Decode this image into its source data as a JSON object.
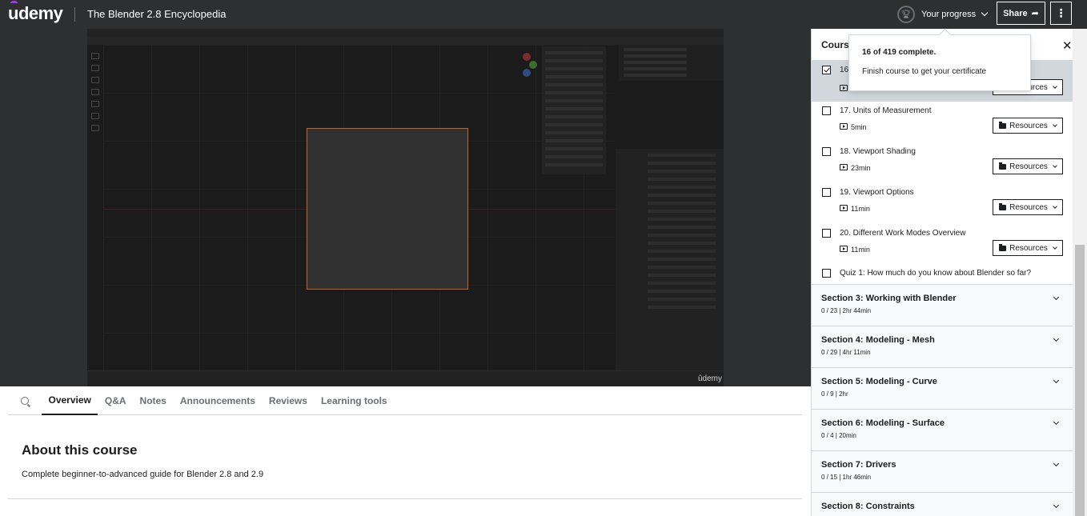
{
  "header": {
    "logo": "udemy",
    "course_title": "The Blender 2.8 Encyclopedia",
    "progress_label": "Your progress",
    "share_label": "Share",
    "more_label": "⋮"
  },
  "video": {
    "watermark": "ûdemy"
  },
  "tabs": {
    "items": [
      "Overview",
      "Q&A",
      "Notes",
      "Announcements",
      "Reviews",
      "Learning tools"
    ],
    "active": "Overview"
  },
  "about": {
    "title": "About this course",
    "description": "Complete beginner-to-advanced guide for Blender 2.8 and 2.9"
  },
  "sidebar": {
    "title": "Course content",
    "resources_label": "Resources",
    "lectures": [
      {
        "title": "16. ",
        "duration": "",
        "checked": true,
        "current": true
      },
      {
        "title": "17. Units of Measurement",
        "duration": "5min",
        "checked": false
      },
      {
        "title": "18. Viewport Shading",
        "duration": "23min",
        "checked": false
      },
      {
        "title": "19. Viewport Options",
        "duration": "11min",
        "checked": false
      },
      {
        "title": "20. Different Work Modes Overview",
        "duration": "11min",
        "checked": false
      }
    ],
    "quiz": {
      "title": "Quiz 1: How much do you know about Blender so far?"
    },
    "sections": [
      {
        "title": "Section 3: Working with Blender",
        "meta": "0 / 23 | 2hr 44min"
      },
      {
        "title": "Section 4: Modeling - Mesh",
        "meta": "0 / 29 | 4hr 11min"
      },
      {
        "title": "Section 5: Modeling - Curve",
        "meta": "0 / 9 | 2hr"
      },
      {
        "title": "Section 6: Modeling - Surface",
        "meta": "0 / 4 | 20min"
      },
      {
        "title": "Section 7: Drivers",
        "meta": "0 / 15 | 1hr 46min"
      },
      {
        "title": "Section 8: Constraints",
        "meta": ""
      }
    ]
  },
  "popup": {
    "main": "16 of 419 complete.",
    "sub": "Finish course to get your certificate"
  },
  "colors": {
    "header_bg": "#2d2f31",
    "accent": "#a435f0",
    "section_bg": "#f7f9fa"
  }
}
